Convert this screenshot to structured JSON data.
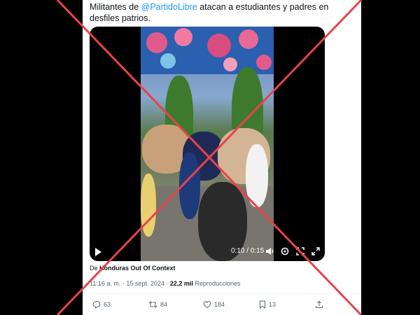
{
  "tweet": {
    "text_before": "Militantes de ",
    "mention": "@PartidoLibre",
    "text_after": " atacan a estudiantes y padres en desfiles patrios."
  },
  "video": {
    "time": "0:10 / 0:15",
    "controls": [
      "play-icon",
      "settings-icon",
      "volume-icon",
      "fullscreen-icon",
      "expand-icon"
    ]
  },
  "attribution": {
    "prefix": "De ",
    "source": "Honduras Out Of Context"
  },
  "meta": {
    "timestamp": "11:16 a. m. · 15 sept. 2024 · ",
    "views_count": "22,2 mil",
    "views_label": " Reproducciones"
  },
  "actions": {
    "replies": "63",
    "reposts": "84",
    "likes": "184",
    "bookmarks": "13"
  },
  "colors": {
    "accent": "#1d9bf0",
    "cross": "#e8434a"
  }
}
